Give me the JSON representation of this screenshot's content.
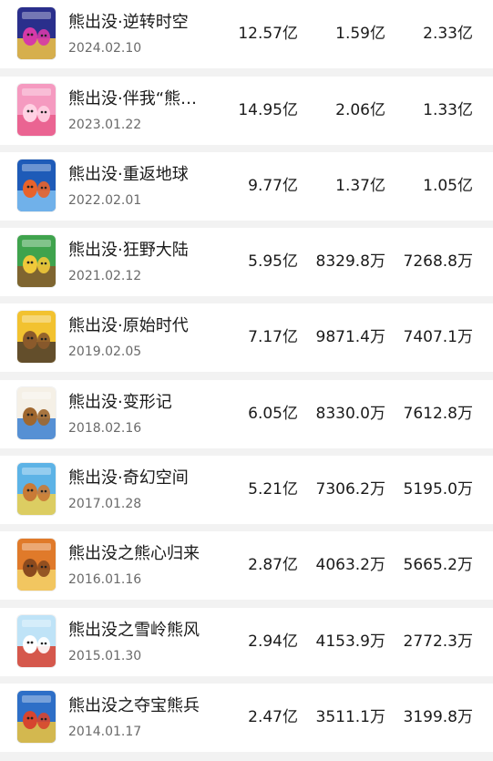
{
  "movies": [
    {
      "title": "熊出没·逆转时空",
      "date": "2024.02.10",
      "v1": "12.57亿",
      "v2": "1.59亿",
      "v3": "2.33亿",
      "poster_colors": [
        "#2a2f8c",
        "#d63aa8",
        "#f4c542"
      ]
    },
    {
      "title": "熊出没·伴我“熊…",
      "date": "2023.01.22",
      "v1": "14.95亿",
      "v2": "2.06亿",
      "v3": "1.33亿",
      "poster_colors": [
        "#f59ac0",
        "#ffd1e3",
        "#e85a8a"
      ]
    },
    {
      "title": "熊出没·重返地球",
      "date": "2022.02.01",
      "v1": "9.77亿",
      "v2": "1.37亿",
      "v3": "1.05亿",
      "poster_colors": [
        "#1e5bb8",
        "#e8632b",
        "#7fc1f2"
      ]
    },
    {
      "title": "熊出没·狂野大陆",
      "date": "2021.02.12",
      "v1": "5.95亿",
      "v2": "8329.8万",
      "v3": "7268.8万",
      "poster_colors": [
        "#3fa34d",
        "#f0c93a",
        "#8b5a2b"
      ]
    },
    {
      "title": "熊出没·原始时代",
      "date": "2019.02.05",
      "v1": "7.17亿",
      "v2": "9871.4万",
      "v3": "7407.1万",
      "poster_colors": [
        "#f2c230",
        "#8b5a2b",
        "#4a3a2a"
      ]
    },
    {
      "title": "熊出没·变形记",
      "date": "2018.02.16",
      "v1": "6.05亿",
      "v2": "8330.0万",
      "v3": "7612.8万",
      "poster_colors": [
        "#f5f0e6",
        "#a0672e",
        "#3a7fd0"
      ]
    },
    {
      "title": "熊出没·奇幻空间",
      "date": "2017.01.28",
      "v1": "5.21亿",
      "v2": "7306.2万",
      "v3": "5195.0万",
      "poster_colors": [
        "#5db3e6",
        "#c97a36",
        "#f2d14a"
      ]
    },
    {
      "title": "熊出没之熊心归来",
      "date": "2016.01.16",
      "v1": "2.87亿",
      "v2": "4063.2万",
      "v3": "5665.2万",
      "poster_colors": [
        "#e07a2a",
        "#8b4a1e",
        "#f4d36a"
      ]
    },
    {
      "title": "熊出没之雪岭熊风",
      "date": "2015.01.30",
      "v1": "2.94亿",
      "v2": "4153.9万",
      "v3": "2772.3万",
      "poster_colors": [
        "#bfe3f7",
        "#ffffff",
        "#d8402e"
      ]
    },
    {
      "title": "熊出没之夺宝熊兵",
      "date": "2014.01.17",
      "v1": "2.47亿",
      "v2": "3511.1万",
      "v3": "3199.8万",
      "poster_colors": [
        "#2e6fc7",
        "#d6452f",
        "#f0c63a"
      ]
    }
  ]
}
